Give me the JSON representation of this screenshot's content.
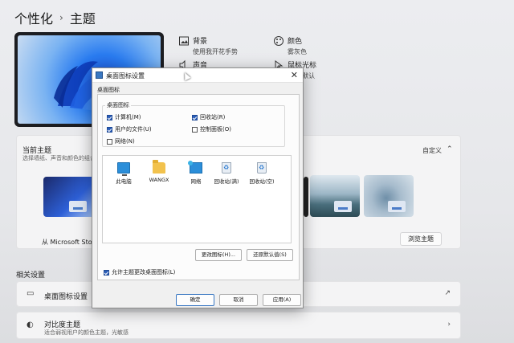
{
  "breadcrumb": {
    "parent": "个性化",
    "separator": "›",
    "current": "主题"
  },
  "options": {
    "background": {
      "title": "背景",
      "sub": "使用我开花手势"
    },
    "color": {
      "title": "颜色",
      "sub": "雾灰色"
    },
    "sound": {
      "title": "声音"
    },
    "cursor": {
      "title": "鼠标光标",
      "sub": "ows 默认"
    }
  },
  "current_theme": {
    "title": "当前主题",
    "subtitle": "选择墙纸、声音和颜色的组合",
    "custom_label": "自定义",
    "from_store": "从 Microsoft Store",
    "browse_button": "浏览主题"
  },
  "related": {
    "heading": "相关设置",
    "desktop_icons": "桌面图标设置",
    "contrast": {
      "title": "对比度主题",
      "sub": "适合弱视用户的颜色主题，光敏感"
    }
  },
  "dialog": {
    "title": "桌面图标设置",
    "tab": "桌面图标",
    "group_label": "桌面图标",
    "checkboxes": [
      {
        "label": "计算机(M)",
        "checked": true
      },
      {
        "label": "回收站(R)",
        "checked": true
      },
      {
        "label": "用户的文件(U)",
        "checked": true
      },
      {
        "label": "控制面板(O)",
        "checked": false
      },
      {
        "label": "网络(N)",
        "checked": false
      }
    ],
    "icons": [
      {
        "label": "此电脑",
        "icon": "computer-icon"
      },
      {
        "label": "WANGX",
        "icon": "folder-icon"
      },
      {
        "label": "网络",
        "icon": "network-icon"
      },
      {
        "label": "回收站(满)",
        "icon": "recycle-bin-full-icon"
      },
      {
        "label": "回收站(空)",
        "icon": "recycle-bin-empty-icon"
      }
    ],
    "change_icon_button": "更改图标(H)...",
    "restore_default_button": "还原默认值(S)",
    "allow_themes_label": "允许主题更改桌面图标(L)",
    "allow_themes_checked": true,
    "ok_button": "确定",
    "cancel_button": "取消",
    "apply_button": "应用(A)"
  }
}
